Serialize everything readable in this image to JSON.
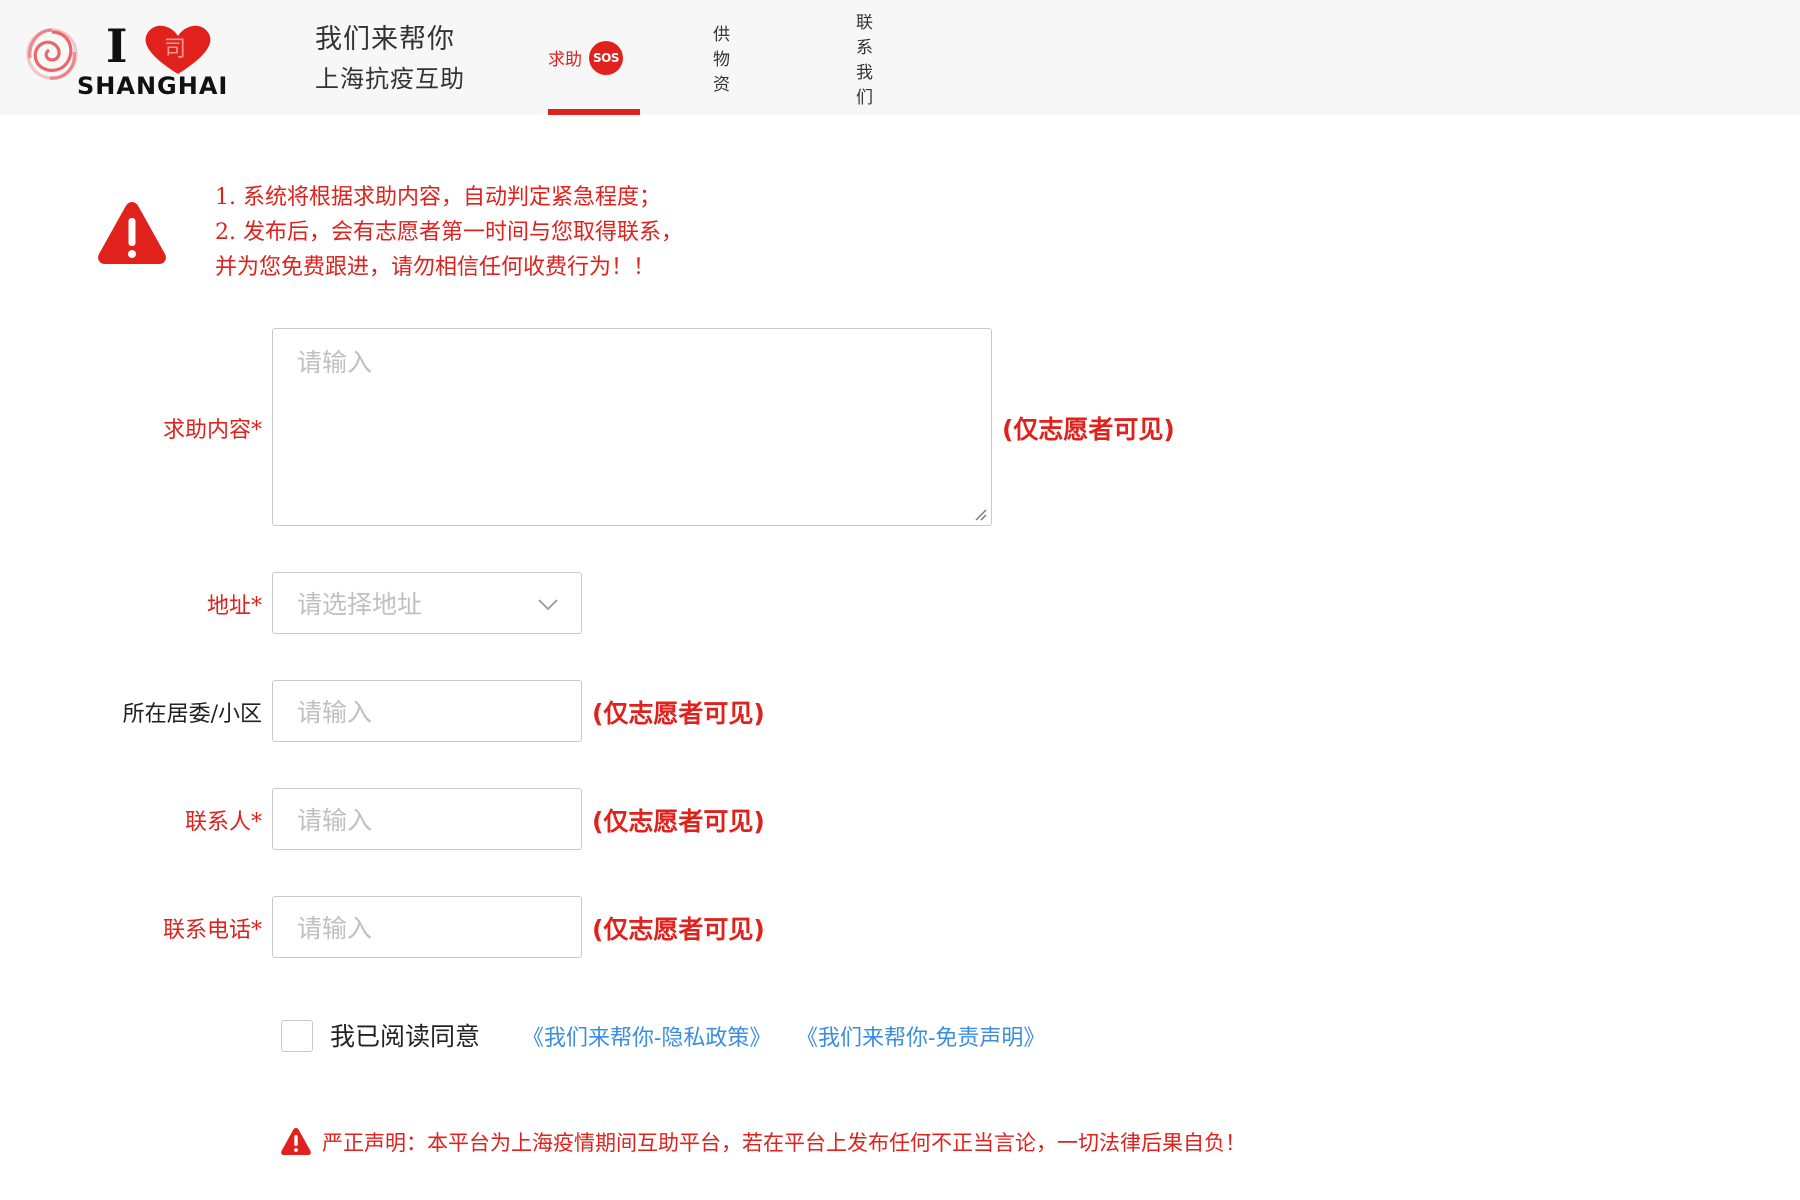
{
  "colors": {
    "accent_red": "#e0211c",
    "link_blue": "#3b8de0",
    "header_bg": "#f7f7f7",
    "border_gray": "#c9c9c9",
    "placeholder_gray": "#c0c0c0"
  },
  "logo": {
    "letter": "I",
    "city": "SHANGHAI",
    "heart_char": "司",
    "icons": [
      "spiral-logo-icon",
      "heart-icon"
    ]
  },
  "brand": {
    "title": "我们来帮你",
    "subtitle": "上海抗疫互助"
  },
  "nav": {
    "items": [
      {
        "label": "求助",
        "badge": "SOS",
        "active": true
      },
      {
        "label": "供物资"
      },
      {
        "label": "联系我们"
      }
    ]
  },
  "notice": {
    "icon": "warning-triangle-icon",
    "lines": [
      "1. 系统将根据求助内容，自动判定紧急程度；",
      "2. 发布后，会有志愿者第一时间与您取得联系，",
      "并为您免费跟进，请勿相信任何收费行为！！"
    ]
  },
  "form": {
    "help_content": {
      "label": "求助内容*",
      "placeholder": "请输入",
      "value": "",
      "note": "(仅志愿者可见)"
    },
    "address": {
      "label": "地址*",
      "selected": "请选择地址",
      "icon": "chevron-down-icon"
    },
    "community": {
      "label": "所在居委/小区",
      "placeholder": "请输入",
      "value": "",
      "note": "(仅志愿者可见)"
    },
    "contact_person": {
      "label": "联系人*",
      "placeholder": "请输入",
      "value": "",
      "note": "(仅志愿者可见)"
    },
    "contact_phone": {
      "label": "联系电话*",
      "placeholder": "请输入",
      "value": "",
      "note": "(仅志愿者可见)"
    }
  },
  "agreement": {
    "checked": false,
    "text": "我已阅读同意",
    "privacy_link": "《我们来帮你-隐私政策》",
    "disclaimer_link": "《我们来帮你-免责声明》"
  },
  "footer": {
    "icon": "warning-triangle-icon",
    "text": "严正声明：本平台为上海疫情期间互助平台，若在平台上发布任何不正当言论，一切法律后果自负！"
  }
}
